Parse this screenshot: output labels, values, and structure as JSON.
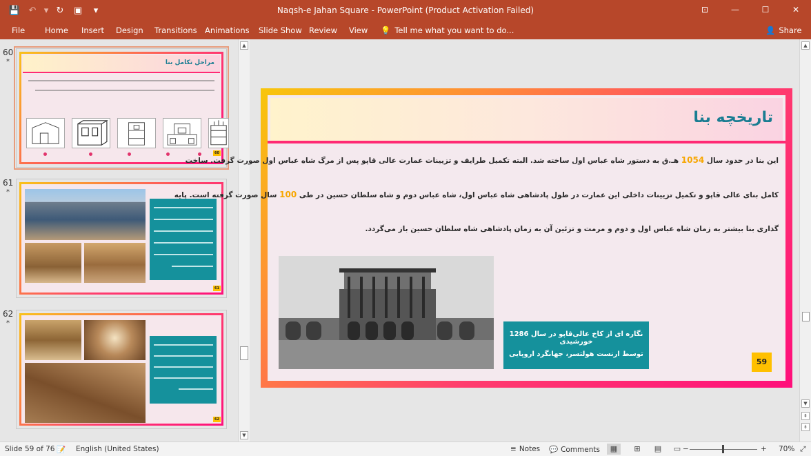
{
  "app": {
    "title": "Naqsh-e Jahan Square - PowerPoint (Product Activation Failed)",
    "accent": "#b7472a"
  },
  "qat": {
    "save_icon": "💾",
    "undo_icon": "↶",
    "undo_drop": "▾",
    "redo_icon": "↻",
    "present_icon": "▣",
    "customize_icon": "▾"
  },
  "window": {
    "options_icon": "⊡",
    "minimize_icon": "—",
    "maximize_icon": "☐",
    "close_icon": "✕"
  },
  "ribbon": {
    "tabs": [
      "File",
      "Home",
      "Insert",
      "Design",
      "Transitions",
      "Animations",
      "Slide Show",
      "Review",
      "View"
    ],
    "tell_me_icon": "💡",
    "tell_me": "Tell me what you want to do...",
    "share_icon": "👤",
    "share": "Share"
  },
  "thumbnails": [
    {
      "number": "60",
      "star": "*",
      "title": "مراحل تکامل بنا",
      "page": "60"
    },
    {
      "number": "61",
      "star": "*",
      "page": "61"
    },
    {
      "number": "62",
      "star": "*",
      "page": "62"
    }
  ],
  "slide": {
    "title": "تاریخچه بنا",
    "para1_a": "این بنا در حدود سال ",
    "para1_hl": "1054",
    "para1_b": " هـ.ق به دستور شاه عباس اول ساخته شد. البته تکمیل طرایف و تزیینات عمارت عالی قاپو پس از مرگ شاه عباس اول صورت گرفت. ساخت",
    "para2_a": "کامل بنای عالی قاپو و تکمیل تزیینات داخلی این عمارت در طول پادشاهی شاه عباس اول، شاه عباس دوم و شاه سلطان حسین در طی ",
    "para2_hl": "100",
    "para2_b": " سال صورت گرفته است. پایه",
    "para3": "گذاری بنا بیشتر به زمان شاه عباس اول و دوم و مرمت و تزئین آن به زمان پادشاهی شاه سلطان حسین باز می‌گردد.",
    "caption_line1": "نگاره ای از کاخ عالی‌قاپو در سال 1286 خورشیدی",
    "caption_line2": "توسط ارنست هولتسر، جهانگرد اروپایی",
    "page_number": "59",
    "colors": {
      "title": "#1a7d92",
      "highlight": "#f7a600",
      "caption_bg": "#15919c",
      "badge": "#ffc000"
    }
  },
  "scroll": {
    "up": "▲",
    "down": "▼",
    "prev": "⇞",
    "next": "⇟"
  },
  "status": {
    "slide_info": "Slide 59 of 76",
    "notes_icon": "📝",
    "language": "English (United States)",
    "notes_btn_icon": "≡",
    "notes": "Notes",
    "comments_btn_icon": "💬",
    "comments": "Comments",
    "view_normal_icon": "▦",
    "view_sorter_icon": "⊞",
    "view_reading_icon": "▤",
    "view_show_icon": "▭",
    "zoom_minus": "−",
    "zoom_plus": "+",
    "zoom": "70%",
    "fit_icon": "⤢"
  }
}
